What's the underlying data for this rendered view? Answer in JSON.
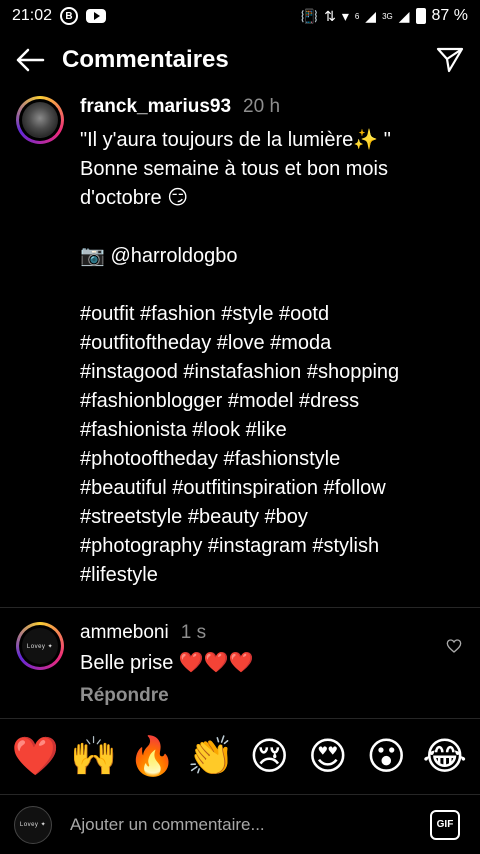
{
  "status_bar": {
    "time": "21:02",
    "signal_badge": "6",
    "network_badge": "3G",
    "battery": "87 %"
  },
  "header": {
    "title": "Commentaires"
  },
  "caption": {
    "username": "franck_marius93",
    "time": "20 h",
    "lines": [
      "\"Il y'aura toujours de la lumière✨ \"",
      "Bonne semaine à tous et bon mois",
      "d'octobre 😏",
      "",
      "📷 @harroldogbo",
      "",
      "#outfit #fashion #style #ootd",
      "#outfitoftheday #love #moda",
      "#instagood #instafashion #shopping",
      "#fashionblogger #model #dress",
      "#fashionista #look #like",
      "#photooftheday #fashionstyle",
      "#beautiful #outfitinspiration #follow",
      "#streetstyle #beauty #boy",
      "#photography #instagram #stylish",
      "#lifestyle"
    ]
  },
  "comment": {
    "username": "ammeboni",
    "time": "1 s",
    "text": "Belle prise ❤️❤️❤️",
    "reply_label": "Répondre"
  },
  "emoji_bar": [
    "❤️",
    "🙌",
    "🔥",
    "👏",
    "😢",
    "😍",
    "😮",
    "😂"
  ],
  "input": {
    "placeholder": "Ajouter un commentaire...",
    "gif_label": "GIF"
  },
  "avatar_logo_text": "Lovey ✦"
}
